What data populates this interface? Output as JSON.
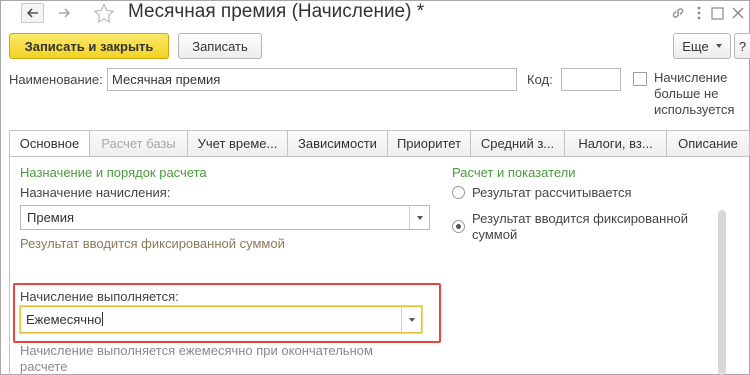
{
  "window": {
    "title": "Месячная премия (Начисление) *"
  },
  "toolbar": {
    "save_close_label": "Записать и закрыть",
    "save_label": "Записать",
    "more_label": "Еще",
    "help_label": "?"
  },
  "header": {
    "name_label": "Наименование:",
    "name_value": "Месячная премия",
    "code_label": "Код:",
    "code_value": "",
    "not_used_label": "Начисление больше не используется",
    "not_used_checked": false
  },
  "tabs": [
    {
      "label": "Основное",
      "state": "active"
    },
    {
      "label": "Расчет базы",
      "state": "disabled"
    },
    {
      "label": "Учет време...",
      "state": "normal"
    },
    {
      "label": "Зависимости",
      "state": "normal"
    },
    {
      "label": "Приоритет",
      "state": "normal"
    },
    {
      "label": "Средний з...",
      "state": "normal"
    },
    {
      "label": "Налоги, вз...",
      "state": "normal"
    },
    {
      "label": "Описание",
      "state": "normal"
    }
  ],
  "main": {
    "purpose_group_title": "Назначение и порядок расчета",
    "purpose_label": "Назначение начисления:",
    "purpose_value": "Премия",
    "purpose_hint": "Результат вводится фиксированной суммой",
    "frequency_label": "Начисление выполняется:",
    "frequency_value": "Ежемесячно",
    "frequency_hint": "Начисление выполняется ежемесячно при окончательном расчете",
    "calc_group_title": "Расчет и показатели",
    "radio_calculated": "Результат рассчитывается",
    "radio_fixed": "Результат вводится фиксированной суммой",
    "selected_mode": "fixed"
  },
  "icons": {
    "back": "arrow-left-icon",
    "forward": "arrow-right-icon",
    "favorite": "star-icon",
    "link": "link-icon",
    "menu": "more-vertical-icon",
    "maximize": "maximize-icon",
    "close": "close-icon",
    "dropdown": "chevron-down-icon"
  },
  "colors": {
    "primary_button": "#f2d322",
    "group_title": "#4a9a3b",
    "highlight_box": "#e8453c",
    "focus_border": "#e2c23a"
  }
}
